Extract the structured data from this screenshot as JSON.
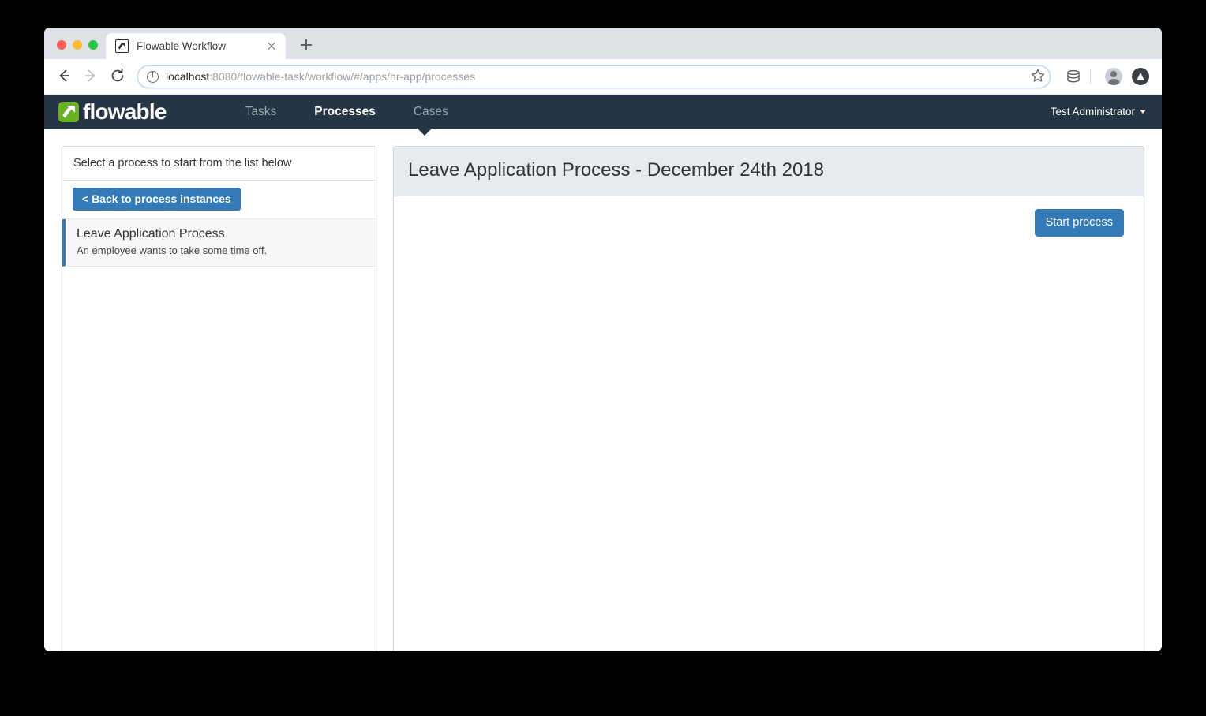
{
  "browser": {
    "tab": {
      "title": "Flowable Workflow",
      "favicon": "flowable-favicon",
      "close": "×"
    },
    "new_tab_label": "+",
    "nav": {
      "back": "←",
      "forward": "→",
      "reload": "⟳"
    },
    "omnibox": {
      "security_label": "i",
      "host": "localhost",
      "path": ":8080/flowable-task/workflow/#/apps/hr-app/processes",
      "full_url": "localhost:8080/flowable-task/workflow/#/apps/hr-app/processes"
    },
    "toolbar_icons": [
      "bookmark-star-icon",
      "database-stack-icon",
      "profile-avatar-icon",
      "update-arrow-icon"
    ]
  },
  "navbar": {
    "brand": "flowable",
    "brand_color": "#6ab023",
    "background": "#253545",
    "links": [
      {
        "label": "Tasks",
        "active": false
      },
      {
        "label": "Processes",
        "active": true
      },
      {
        "label": "Cases",
        "active": false
      }
    ],
    "user": "Test Administrator"
  },
  "left_panel": {
    "header": "Select a process to start from the list below",
    "back_button": "< Back to process instances",
    "items": [
      {
        "title": "Leave Application Process",
        "description": "An employee wants to take some time off.",
        "selected": true
      }
    ]
  },
  "right_panel": {
    "title": "Leave Application Process - December 24th 2018",
    "start_button": "Start process"
  },
  "colors": {
    "accent_blue": "#337ab7",
    "navbar_dark": "#253545",
    "header_band": "#e7ebef",
    "brand_green": "#6ab023"
  }
}
